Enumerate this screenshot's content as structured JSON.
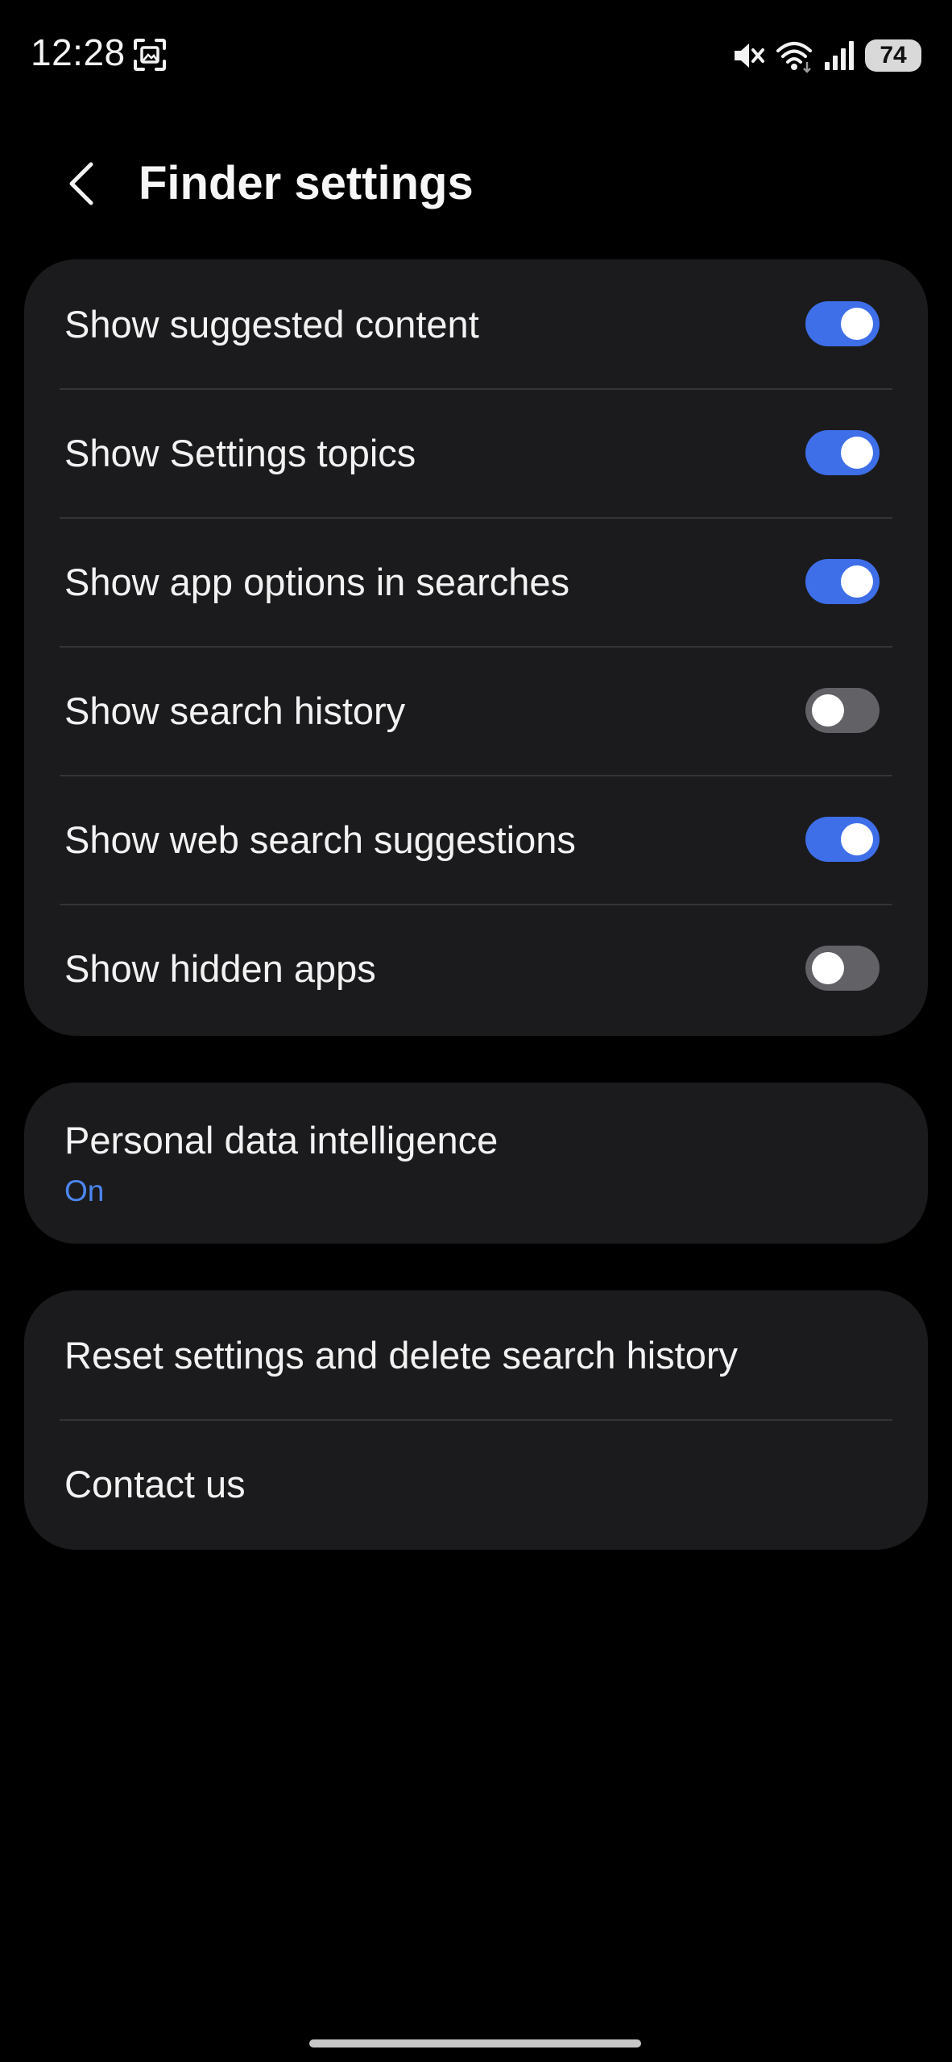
{
  "status_bar": {
    "time": "12:28",
    "battery": "74",
    "icons": [
      "screenshot-icon",
      "mute-icon",
      "wifi-icon",
      "signal-icon",
      "battery-icon"
    ]
  },
  "header": {
    "title": "Finder settings",
    "back_icon": "chevron-left-icon"
  },
  "toggles": [
    {
      "label": "Show suggested content",
      "on": true
    },
    {
      "label": "Show Settings topics",
      "on": true
    },
    {
      "label": "Show app options in searches",
      "on": true
    },
    {
      "label": "Show search history",
      "on": false
    },
    {
      "label": "Show web search suggestions",
      "on": true
    },
    {
      "label": "Show hidden apps",
      "on": false
    }
  ],
  "personal_data": {
    "title": "Personal data intelligence",
    "status": "On"
  },
  "misc": {
    "reset_label": "Reset settings and delete search history",
    "contact_label": "Contact us"
  },
  "colors": {
    "background": "#000000",
    "card": "#1b1b1d",
    "toggle_on": "#3e6ee8",
    "toggle_off": "#616166",
    "accent_text": "#4c86f0"
  }
}
